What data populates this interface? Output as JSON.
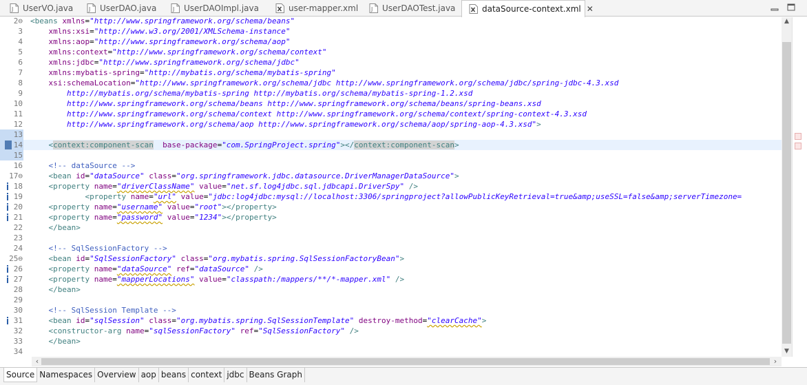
{
  "editor_tabs": [
    {
      "label": "UserVO.java",
      "icon": "java-file-icon",
      "active": false
    },
    {
      "label": "UserDAO.java",
      "icon": "java-file-icon",
      "active": false
    },
    {
      "label": "UserDAOImpl.java",
      "icon": "java-file-icon",
      "active": false
    },
    {
      "label": "user-mapper.xml",
      "icon": "xml-file-icon",
      "active": false
    },
    {
      "label": "UserDAOTest.java",
      "icon": "java-file-icon",
      "active": false
    },
    {
      "label": "dataSource-context.xml",
      "icon": "xml-file-icon",
      "active": true
    }
  ],
  "window_controls": {
    "minimize": "minimize-icon",
    "maximize": "maximize-icon"
  },
  "lines": [
    {
      "n": "2",
      "mark": "fold",
      "segs": [
        [
          "tag",
          "<beans "
        ],
        [
          "attr",
          "xmlns"
        ],
        [
          "",
          "="
        ],
        [
          "str",
          "\"http://www.springframework.org/schema/beans\""
        ]
      ]
    },
    {
      "n": "3",
      "segs": [
        [
          "",
          "    "
        ],
        [
          "attr",
          "xmlns:xsi"
        ],
        [
          "",
          "="
        ],
        [
          "str",
          "\"http://www.w3.org/2001/XMLSchema-instance\""
        ]
      ]
    },
    {
      "n": "4",
      "segs": [
        [
          "",
          "    "
        ],
        [
          "attr",
          "xmlns:aop"
        ],
        [
          "",
          "="
        ],
        [
          "str",
          "\"http://www.springframework.org/schema/aop\""
        ]
      ]
    },
    {
      "n": "5",
      "segs": [
        [
          "",
          "    "
        ],
        [
          "attr",
          "xmlns:context"
        ],
        [
          "",
          "="
        ],
        [
          "str",
          "\"http://www.springframework.org/schema/context\""
        ]
      ]
    },
    {
      "n": "6",
      "segs": [
        [
          "",
          "    "
        ],
        [
          "attr",
          "xmlns:jdbc"
        ],
        [
          "",
          "="
        ],
        [
          "str",
          "\"http://www.springframework.org/schema/jdbc\""
        ]
      ]
    },
    {
      "n": "7",
      "segs": [
        [
          "",
          "    "
        ],
        [
          "attr",
          "xmlns:mybatis-spring"
        ],
        [
          "",
          "="
        ],
        [
          "str",
          "\"http://mybatis.org/schema/mybatis-spring\""
        ]
      ]
    },
    {
      "n": "8",
      "segs": [
        [
          "",
          "    "
        ],
        [
          "attr",
          "xsi:schemaLocation"
        ],
        [
          "",
          "="
        ],
        [
          "str",
          "\"http://www.springframework.org/schema/jdbc http://www.springframework.org/schema/jdbc/spring-jdbc-4.3.xsd"
        ]
      ]
    },
    {
      "n": "9",
      "segs": [
        [
          "",
          "        "
        ],
        [
          "str",
          "http://mybatis.org/schema/mybatis-spring http://mybatis.org/schema/mybatis-spring-1.2.xsd"
        ]
      ]
    },
    {
      "n": "10",
      "segs": [
        [
          "",
          "        "
        ],
        [
          "str",
          "http://www.springframework.org/schema/beans http://www.springframework.org/schema/beans/spring-beans.xsd"
        ]
      ]
    },
    {
      "n": "11",
      "segs": [
        [
          "",
          "        "
        ],
        [
          "str",
          "http://www.springframework.org/schema/context http://www.springframework.org/schema/context/spring-context-4.3.xsd"
        ]
      ]
    },
    {
      "n": "12",
      "segs": [
        [
          "",
          "        "
        ],
        [
          "str",
          "http://www.springframework.org/schema/aop http://www.springframework.org/schema/aop/spring-aop-4.3.xsd\""
        ],
        [
          "tag",
          ">"
        ]
      ]
    },
    {
      "n": "13",
      "band": true,
      "segs": []
    },
    {
      "n": "14",
      "band": true,
      "bookmark": true,
      "hl": true,
      "segs": [
        [
          "",
          "    "
        ],
        [
          "tag",
          "<"
        ],
        [
          "tag sel",
          "context:component-scan"
        ],
        [
          "",
          "  "
        ],
        [
          "attr",
          "base-package"
        ],
        [
          "",
          "="
        ],
        [
          "str",
          "\"com.SpringProject.spring\""
        ],
        [
          "tag",
          ">"
        ],
        [
          "tag",
          "</"
        ],
        [
          "tag sel",
          "context:component-scan"
        ],
        [
          "tag",
          ">"
        ]
      ]
    },
    {
      "n": "15",
      "band": true,
      "segs": []
    },
    {
      "n": "16",
      "segs": [
        [
          "",
          "    "
        ],
        [
          "cmt",
          "<!-- dataSource -->"
        ]
      ]
    },
    {
      "n": "17",
      "mark": "fold",
      "segs": [
        [
          "",
          "    "
        ],
        [
          "tag",
          "<bean "
        ],
        [
          "attr",
          "id"
        ],
        [
          "",
          "="
        ],
        [
          "str",
          "\"dataSource\""
        ],
        [
          "",
          ""
        ],
        [
          "attr",
          " class"
        ],
        [
          "",
          "="
        ],
        [
          "str",
          "\"org.springframework.jdbc.datasource.DriverManagerDataSource\""
        ],
        [
          "tag",
          ">"
        ]
      ]
    },
    {
      "n": "18",
      "mark": "info",
      "segs": [
        [
          "",
          "    "
        ],
        [
          "tag",
          "<property "
        ],
        [
          "attr",
          "name"
        ],
        [
          "",
          "="
        ],
        [
          "str warn",
          "\"driverClassName\""
        ],
        [
          "",
          ""
        ],
        [
          "attr",
          " value"
        ],
        [
          "",
          "="
        ],
        [
          "str",
          "\"net.sf.log4jdbc.sql.jdbcapi.DriverSpy\""
        ],
        [
          "tag",
          " />"
        ]
      ]
    },
    {
      "n": "19",
      "mark": "info",
      "segs": [
        [
          "",
          "            "
        ],
        [
          "tag",
          "<property "
        ],
        [
          "attr",
          "name"
        ],
        [
          "",
          "="
        ],
        [
          "str warn",
          "\"url\""
        ],
        [
          "",
          ""
        ],
        [
          "attr",
          " value"
        ],
        [
          "",
          "="
        ],
        [
          "str",
          "\"jdbc:log4jdbc:mysql://localhost:3306/springproject?allowPublicKeyRetrieval=true&amp;useSSL=false&amp;serverTimezone="
        ]
      ]
    },
    {
      "n": "20",
      "mark": "info",
      "segs": [
        [
          "",
          "    "
        ],
        [
          "tag",
          "<property "
        ],
        [
          "attr",
          "name"
        ],
        [
          "",
          "="
        ],
        [
          "str warn",
          "\"username\""
        ],
        [
          "",
          ""
        ],
        [
          "attr",
          " value"
        ],
        [
          "",
          "="
        ],
        [
          "str",
          "\"root\""
        ],
        [
          "tag",
          "></property>"
        ]
      ]
    },
    {
      "n": "21",
      "mark": "info",
      "segs": [
        [
          "",
          "    "
        ],
        [
          "tag",
          "<property "
        ],
        [
          "attr",
          "name"
        ],
        [
          "",
          "="
        ],
        [
          "str warn",
          "\"password\""
        ],
        [
          "",
          ""
        ],
        [
          "attr",
          " value"
        ],
        [
          "",
          "="
        ],
        [
          "str",
          "\"1234\""
        ],
        [
          "tag",
          "></property>"
        ]
      ]
    },
    {
      "n": "22",
      "segs": [
        [
          "",
          "    "
        ],
        [
          "tag",
          "</bean>"
        ]
      ]
    },
    {
      "n": "23",
      "segs": []
    },
    {
      "n": "24",
      "segs": [
        [
          "",
          "    "
        ],
        [
          "cmt",
          "<!-- SqlSessionFactory -->"
        ]
      ]
    },
    {
      "n": "25",
      "mark": "fold",
      "segs": [
        [
          "",
          "    "
        ],
        [
          "tag",
          "<bean "
        ],
        [
          "attr",
          "id"
        ],
        [
          "",
          "="
        ],
        [
          "str",
          "\"SqlSessionFactory\""
        ],
        [
          "",
          ""
        ],
        [
          "attr",
          " class"
        ],
        [
          "",
          "="
        ],
        [
          "str",
          "\"org.mybatis.spring.SqlSessionFactoryBean\""
        ],
        [
          "tag",
          ">"
        ]
      ]
    },
    {
      "n": "26",
      "mark": "info",
      "segs": [
        [
          "",
          "    "
        ],
        [
          "tag",
          "<property "
        ],
        [
          "attr",
          "name"
        ],
        [
          "",
          "="
        ],
        [
          "str warn",
          "\"dataSource\""
        ],
        [
          "",
          ""
        ],
        [
          "attr",
          " ref"
        ],
        [
          "",
          "="
        ],
        [
          "str",
          "\"dataSource\""
        ],
        [
          "tag",
          " />"
        ]
      ]
    },
    {
      "n": "27",
      "mark": "info",
      "segs": [
        [
          "",
          "    "
        ],
        [
          "tag",
          "<property "
        ],
        [
          "attr",
          "name"
        ],
        [
          "",
          "="
        ],
        [
          "str warn",
          "\"mapperLocations\""
        ],
        [
          "",
          ""
        ],
        [
          "attr",
          " value"
        ],
        [
          "",
          "="
        ],
        [
          "str",
          "\"classpath:/mappers/**/*-mapper.xml\""
        ],
        [
          "tag",
          " />"
        ]
      ]
    },
    {
      "n": "28",
      "segs": [
        [
          "",
          "    "
        ],
        [
          "tag",
          "</bean>"
        ]
      ]
    },
    {
      "n": "29",
      "segs": []
    },
    {
      "n": "30",
      "segs": [
        [
          "",
          "    "
        ],
        [
          "cmt",
          "<!-- SqlSession Template -->"
        ]
      ]
    },
    {
      "n": "31",
      "mark": "info",
      "segs": [
        [
          "",
          "    "
        ],
        [
          "tag",
          "<bean "
        ],
        [
          "attr",
          "id"
        ],
        [
          "",
          "="
        ],
        [
          "str",
          "\"sqlSession\""
        ],
        [
          "",
          ""
        ],
        [
          "attr",
          " class"
        ],
        [
          "",
          "="
        ],
        [
          "str",
          "\"org.mybatis.spring.SqlSessionTemplate\""
        ],
        [
          "",
          ""
        ],
        [
          "attr",
          " destroy-method"
        ],
        [
          "",
          "="
        ],
        [
          "str warn",
          "\"clearCache\""
        ],
        [
          "tag",
          ">"
        ]
      ]
    },
    {
      "n": "32",
      "segs": [
        [
          "",
          "    "
        ],
        [
          "tag",
          "<constructor-arg "
        ],
        [
          "attr",
          "name"
        ],
        [
          "",
          "="
        ],
        [
          "str",
          "\"sqlSessionFactory\""
        ],
        [
          "",
          ""
        ],
        [
          "attr",
          " ref"
        ],
        [
          "",
          "="
        ],
        [
          "str",
          "\"SqlSessionFactory\""
        ],
        [
          "tag",
          " />"
        ]
      ]
    },
    {
      "n": "33",
      "segs": [
        [
          "",
          "    "
        ],
        [
          "tag",
          "</bean>"
        ]
      ]
    },
    {
      "n": "34",
      "segs": []
    }
  ],
  "page_tabs": [
    {
      "label": "Source",
      "active": true
    },
    {
      "label": "Namespaces",
      "active": false
    },
    {
      "label": "Overview",
      "active": false
    },
    {
      "label": "aop",
      "active": false
    },
    {
      "label": "beans",
      "active": false
    },
    {
      "label": "context",
      "active": false
    },
    {
      "label": "jdbc",
      "active": false
    },
    {
      "label": "Beans Graph",
      "active": false
    }
  ],
  "colors": {
    "tag": "#3f7f7f",
    "attribute": "#7f007f",
    "string": "#2a00ff",
    "comment": "#3f5fbf",
    "current_line": "#e8f2fe",
    "info_marker": "#2a5ea8"
  }
}
